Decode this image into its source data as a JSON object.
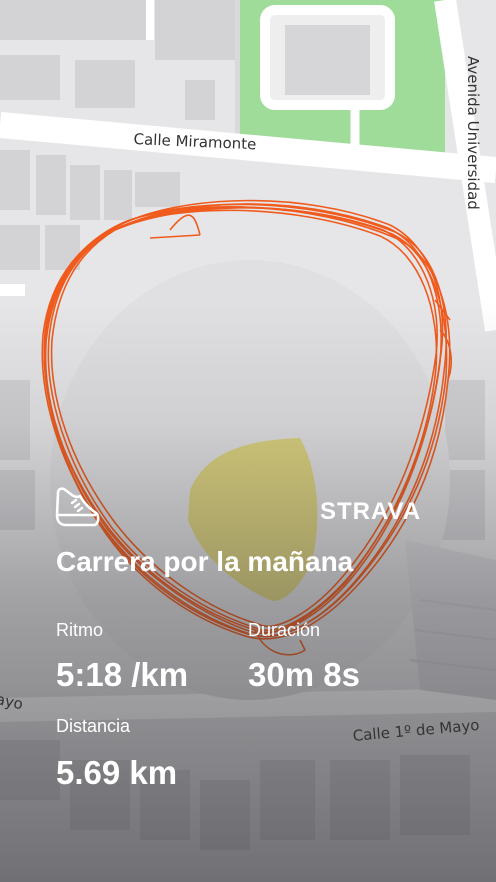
{
  "map": {
    "street_top": "Calle Miramonte",
    "street_right": "Avenida Universidad",
    "street_bottom": "Calle 1º de Mayo",
    "street_left": "ayo",
    "route_color": "#f05a1c"
  },
  "activity": {
    "title": "Carrera por la mañana",
    "brand": "STRAVA",
    "sport_icon": "running-shoe-icon"
  },
  "stats": {
    "pace_label": "Ritmo",
    "pace_value": "5:18 /km",
    "duration_label": "Duración",
    "duration_value": "30m 8s",
    "distance_label": "Distancia",
    "distance_value": "5.69 km"
  }
}
